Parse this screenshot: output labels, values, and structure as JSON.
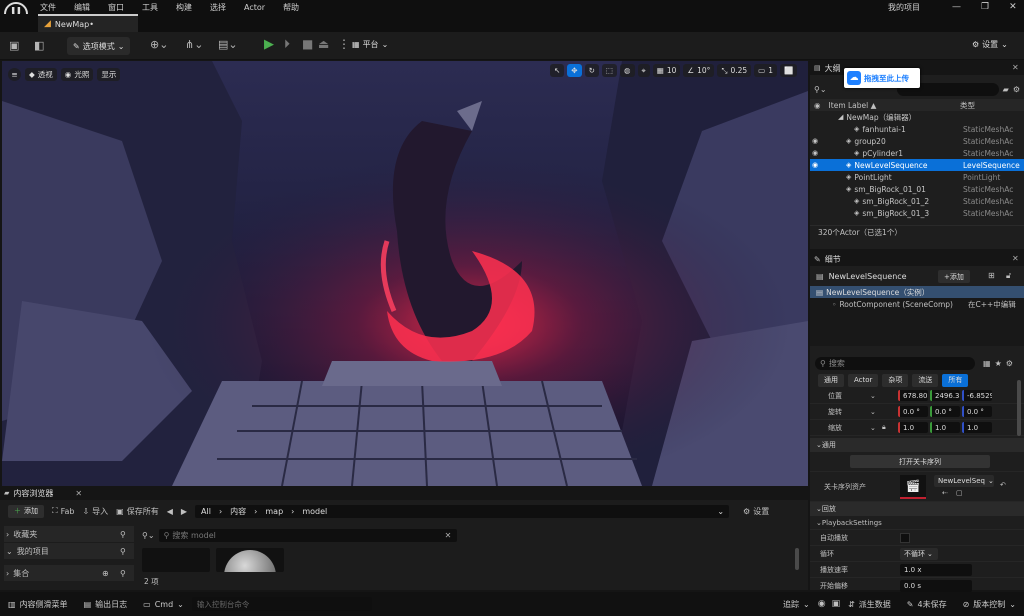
{
  "menu": {
    "items": [
      "文件",
      "编辑",
      "窗口",
      "工具",
      "构建",
      "选择",
      "Actor",
      "帮助"
    ],
    "project": "我的项目"
  },
  "tab": {
    "label": "NewMap•"
  },
  "toolbar": {
    "mode": "选项模式",
    "platform": "平台",
    "settings": "设置"
  },
  "viewport": {
    "perspective": "透视",
    "lighting": "光照",
    "show": "显示",
    "grid": "10",
    "angle": "10°",
    "scale": "0.25",
    "cam": "1"
  },
  "upload": {
    "label": "拖拽至此上传"
  },
  "outliner": {
    "title": "大纲",
    "col_label": "Item Label ▲",
    "col_type": "类型",
    "rows": [
      {
        "label": "NewMap（编辑器）",
        "type": "",
        "indent": 0,
        "eye": false,
        "sel": false
      },
      {
        "label": "fanhuntai-1",
        "type": "StaticMeshAc",
        "indent": 2,
        "eye": false,
        "sel": false
      },
      {
        "label": "group20",
        "type": "StaticMeshAc",
        "indent": 1,
        "eye": true,
        "sel": false
      },
      {
        "label": "pCylinder1",
        "type": "StaticMeshAc",
        "indent": 2,
        "eye": true,
        "sel": false
      },
      {
        "label": "NewLevelSequence",
        "type": "LevelSequence",
        "indent": 1,
        "eye": true,
        "sel": true
      },
      {
        "label": "PointLight",
        "type": "PointLight",
        "indent": 1,
        "eye": false,
        "sel": false
      },
      {
        "label": "sm_BigRock_01_01",
        "type": "StaticMeshAc",
        "indent": 1,
        "eye": false,
        "sel": false
      },
      {
        "label": "sm_BigRock_01_2",
        "type": "StaticMeshAc",
        "indent": 2,
        "eye": false,
        "sel": false
      },
      {
        "label": "sm_BigRock_01_3",
        "type": "StaticMeshAc",
        "indent": 2,
        "eye": false,
        "sel": false
      }
    ],
    "count": "320个Actor（已选1个）"
  },
  "details": {
    "title": "细节",
    "object": "NewLevelSequence",
    "add": "+添加",
    "comp_instance": "NewLevelSequence（实例）",
    "comp_root": "RootComponent (SceneComp)",
    "comp_edit": "在C++中编辑",
    "search": "搜索",
    "filters": [
      "通用",
      "Actor",
      "杂项",
      "流送",
      "所有"
    ],
    "location_label": "位置",
    "location": [
      "678.801",
      "2496.38",
      "-6.8529"
    ],
    "rotation_label": "旋转",
    "rotation": [
      "0.0 °",
      "0.0 °",
      "0.0 °"
    ],
    "scale_label": "缩放",
    "scale": [
      "1.0",
      "1.0",
      "1.0"
    ],
    "general_section": "通用",
    "open_sequence": "打开关卡序列",
    "sequence_asset_label": "关卡序列资产",
    "sequence_asset": "NewLevelSeq",
    "callback_section": "回放",
    "playback_section": "PlaybackSettings",
    "autoplay": "自动播放",
    "loop_label": "循环",
    "loop_value": "不循环",
    "rate_label": "播放速率",
    "rate_value": "1.0 x",
    "offset_label": "开始偏移",
    "offset_value": "0.0 s"
  },
  "content": {
    "title": "内容浏览器",
    "add": "添加",
    "fab": "Fab",
    "import": "导入",
    "save_all": "保存所有",
    "path": [
      "All",
      "内容",
      "map",
      "model"
    ],
    "settings": "设置",
    "favorites": "收藏夹",
    "my_project": "我的项目",
    "collections": "集合",
    "search_placeholder": "搜索 model",
    "item_count": "2 项"
  },
  "status": {
    "drawer": "内容侧滑菜单",
    "log": "输出日志",
    "cmd": "Cmd",
    "console_placeholder": "输入控制台命令",
    "trace": "追踪",
    "derived": "派生数据",
    "unsaved": "4未保存",
    "source": "版本控制"
  }
}
